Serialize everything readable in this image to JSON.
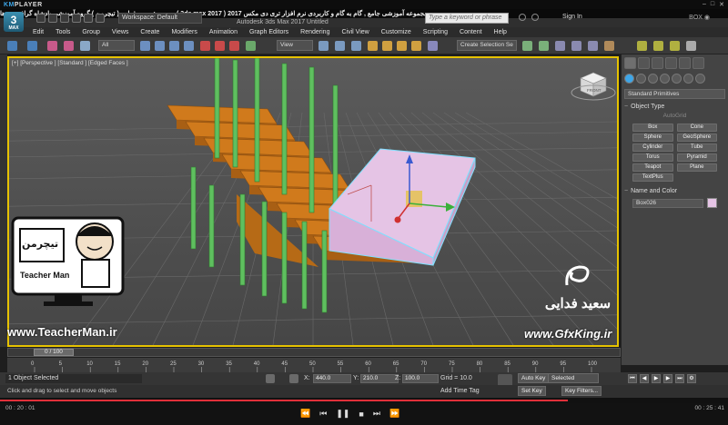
{
  "player": {
    "name_prefix": "KM",
    "name_suffix": "PLAYER",
    "window_controls": [
      "–",
      "□",
      "✕"
    ]
  },
  "banner": {
    "text": "مجموعه آموزشی جامع , گام به گام و کاربردی نرم افزار تری دی مکس 2017 ( 3ds max 2017 ) مدرس : سعید فدایی ( تیچرمن ) گروه آموزشی پادشاه گرافیست ها"
  },
  "app": {
    "icon_text": "3",
    "icon_sub": "MAX",
    "workspace": "Workspace: Default",
    "title": "Autodesk 3ds Max 2017    Untitled",
    "search_placeholder": "Type a keyword or phrase",
    "signin": "Sign In",
    "box_label": "BOX ◉"
  },
  "menu": [
    "Edit",
    "Tools",
    "Group",
    "Views",
    "Create",
    "Modifiers",
    "Animation",
    "Graph Editors",
    "Rendering",
    "Civil View",
    "Customize",
    "Scripting",
    "Content",
    "Help"
  ],
  "toolbar": {
    "filter": "All",
    "view": "View",
    "selection_set": "Create Selection Se"
  },
  "viewport": {
    "label": "[+] [Perspective ] [Standard ] [Edged Faces ]",
    "cube_label": "FRONT"
  },
  "cmd_panel": {
    "category": "Standard Primitives",
    "object_type_title": "Object Type",
    "autogrid": "AutoGrid",
    "buttons": [
      "Box",
      "Cone",
      "Sphere",
      "GeoSphere",
      "Cylinder",
      "Tube",
      "Torus",
      "Pyramid",
      "Teapot",
      "Plane",
      "TextPlus"
    ],
    "name_color_title": "Name and Color",
    "object_name": "Box026",
    "object_color": "#e5c4e5"
  },
  "timeline": {
    "slider": "0 / 100",
    "ticks": [
      "0",
      "5",
      "10",
      "15",
      "20",
      "25",
      "30",
      "35",
      "40",
      "45",
      "50",
      "55",
      "60",
      "65",
      "70",
      "75",
      "80",
      "85",
      "90",
      "95",
      "100"
    ]
  },
  "status": {
    "selection": "1 Object Selected",
    "prompt": "Click and drag to select and move objects",
    "x_label": "X:",
    "x": "440.0",
    "y_label": "Y:",
    "y": "210.0",
    "z_label": "Z:",
    "z": "100.0",
    "grid": "Grid = 10.0",
    "add_time_tag": "Add Time Tag",
    "auto_key": "Auto Key",
    "selected": "Selected",
    "set_key": "Set Key",
    "key_filters": "Key Filters..."
  },
  "watermarks": {
    "teacherman_url": "www.TeacherMan.ir",
    "teacherman_brand": "Teacher Man",
    "teacherman_farsi": "تیچرمن",
    "gfx_farsi": "سعید فدایی",
    "gfx_url": "www.GfxKing.ir"
  },
  "player_bottom": {
    "time_elapsed": "00 : 20 : 01",
    "time_total": "00 : 25 : 41",
    "progress": 0.78
  },
  "colors": {
    "stair": "#d07a1c",
    "rail": "#5fbf5f",
    "box": "#e5c4e5",
    "highlight": "#e6c200"
  }
}
